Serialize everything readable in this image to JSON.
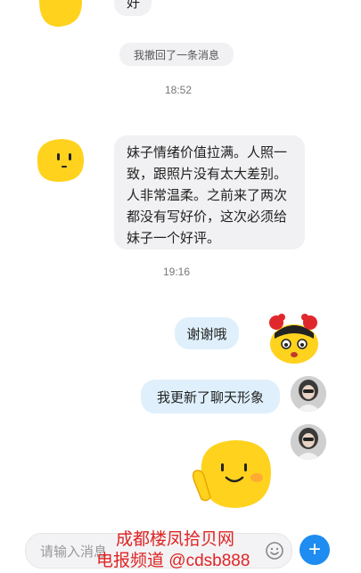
{
  "messages": {
    "top_reply": "好",
    "system_notice": "我撤回了一条消息",
    "time1": "18:52",
    "review_text": "妹子情绪价值拉满。人照一致，跟照片没有太大差别。人非常温柔。之前来了两次都没有写好价，这次必须给妹子一个好评。",
    "time2": "19:16",
    "thanks": "谢谢哦",
    "avatar_update": "我更新了聊天形象"
  },
  "input": {
    "placeholder": "请输入消息"
  },
  "watermark": {
    "line1": "成都楼凤拾贝网",
    "line2": "电报频道 @cdsb888"
  },
  "colors": {
    "blob_yellow": "#ffd21e",
    "send_blue": "#1e8cf0",
    "bubble_right": "#dff0fc",
    "bubble_left": "#f1f1f3",
    "watermark_red": "#e02424"
  }
}
